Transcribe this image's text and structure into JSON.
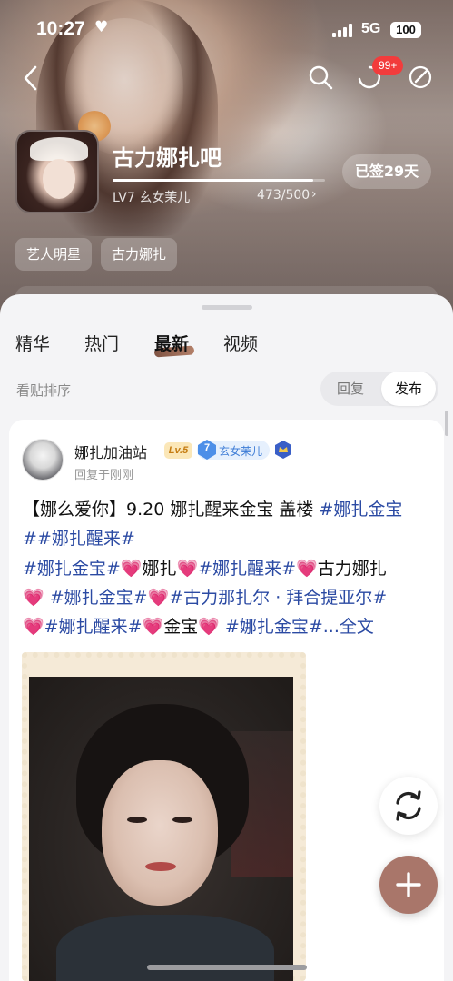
{
  "status_bar": {
    "time": "10:27",
    "network": "5G",
    "battery": "100"
  },
  "header": {
    "notification_badge": "99+",
    "icons": [
      "back-icon",
      "search-icon",
      "share-icon",
      "edit-icon"
    ]
  },
  "forum": {
    "name": "古力娜扎吧",
    "level_title": "LV7 玄女茉儿",
    "level_progress": "473/500",
    "level_progress_fraction": 0.946,
    "signed_label": "已签29天",
    "tags": [
      "艺人明星",
      "古力娜扎"
    ]
  },
  "tabs": [
    {
      "label": "精华",
      "active": false
    },
    {
      "label": "热门",
      "active": false
    },
    {
      "label": "最新",
      "active": true
    },
    {
      "label": "视频",
      "active": false
    }
  ],
  "sort": {
    "label": "看贴排序",
    "options": [
      "回复",
      "发布"
    ],
    "selected": "发布"
  },
  "post": {
    "author": "娜扎加油站",
    "author_level": "Lv.5",
    "fan_level": "7",
    "fan_title": "玄女茉儿",
    "time": "回复于刚刚",
    "lines": [
      {
        "segments": [
          {
            "t": "【娜么爱你】9.20 娜扎醒来金宝 盖楼 ",
            "k": "n"
          },
          {
            "t": "#娜扎金宝",
            "k": "h"
          }
        ]
      },
      {
        "segments": [
          {
            "t": "##娜扎醒来#",
            "k": "h"
          }
        ]
      },
      {
        "segments": [
          {
            "t": "#娜扎金宝#",
            "k": "h"
          },
          {
            "t": "💗",
            "k": "p"
          },
          {
            "t": "娜扎",
            "k": "n"
          },
          {
            "t": "💗",
            "k": "p"
          },
          {
            "t": "#娜扎醒来#",
            "k": "h"
          },
          {
            "t": "💗",
            "k": "p"
          },
          {
            "t": "古力娜扎",
            "k": "n"
          }
        ]
      },
      {
        "segments": [
          {
            "t": "💗",
            "k": "p"
          },
          {
            "t": " #娜扎金宝#",
            "k": "h"
          },
          {
            "t": "💗",
            "k": "p"
          },
          {
            "t": "#古力那扎尔 · 拜合提亚尔#",
            "k": "h"
          }
        ]
      },
      {
        "segments": [
          {
            "t": "💗",
            "k": "p"
          },
          {
            "t": "#娜扎醒来#",
            "k": "h"
          },
          {
            "t": "💗",
            "k": "p"
          },
          {
            "t": "金宝",
            "k": "n"
          },
          {
            "t": "💗",
            "k": "p"
          },
          {
            "t": " #娜扎金宝#",
            "k": "h"
          },
          {
            "t": "...全文",
            "k": "h"
          }
        ]
      }
    ]
  },
  "colors": {
    "hashtag": "#2b4aa3",
    "heart": "#ee3a8c",
    "accent": "#a9766a",
    "badge_red": "#f23c3c"
  }
}
